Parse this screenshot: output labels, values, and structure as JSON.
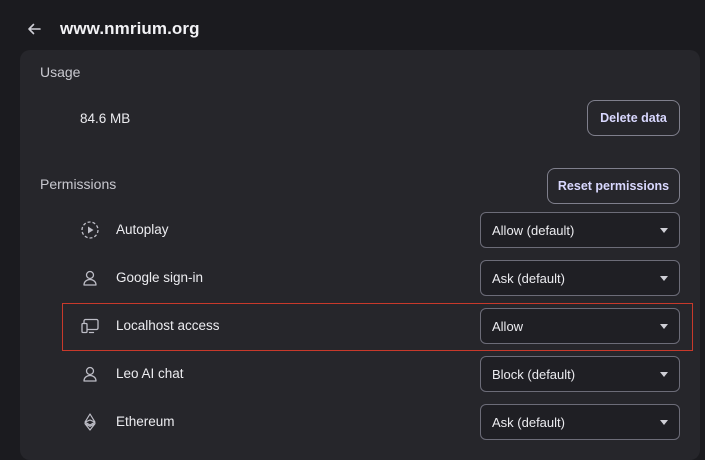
{
  "header": {
    "title": "www.nmrium.org"
  },
  "usage": {
    "section_title": "Usage",
    "value": "84.6 MB",
    "delete_label": "Delete data"
  },
  "permissions": {
    "section_title": "Permissions",
    "reset_label": "Reset permissions",
    "items": [
      {
        "label": "Autoplay",
        "value": "Allow (default)",
        "icon": "autoplay-icon"
      },
      {
        "label": "Google sign-in",
        "value": "Ask (default)",
        "icon": "person-icon"
      },
      {
        "label": "Localhost access",
        "value": "Allow",
        "icon": "localhost-icon"
      },
      {
        "label": "Leo AI chat",
        "value": "Block (default)",
        "icon": "person-icon"
      },
      {
        "label": "Ethereum",
        "value": "Ask (default)",
        "icon": "ethereum-icon"
      }
    ]
  },
  "colors": {
    "background": "#1b1b1f",
    "card": "#26262b",
    "button_text": "#d9d8ff",
    "highlight": "#c8392b"
  }
}
